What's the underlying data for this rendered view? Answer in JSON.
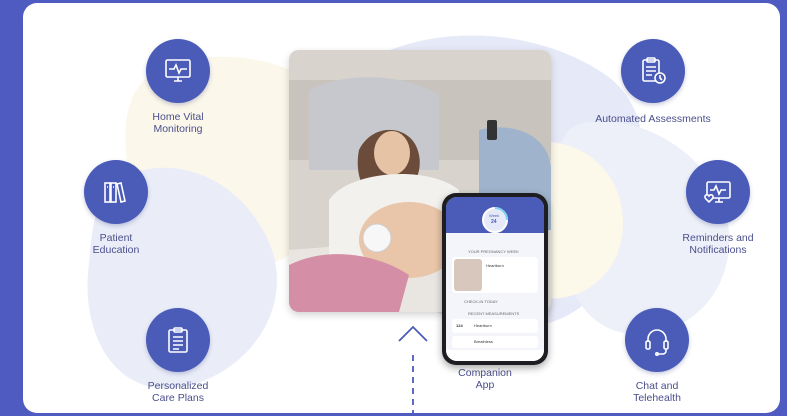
{
  "features": {
    "home_vital": "Home Vital\nMonitoring",
    "patient_education": "Patient\nEducation",
    "care_plans": "Personalized\nCare Plans",
    "companion_app": "Companion\nApp",
    "automated_assessments": "Automated Assessments",
    "reminders": "Reminders and\nNotifications",
    "chat": "Chat and\nTelehealth"
  },
  "icons": {
    "home_vital": "monitor-heart-icon",
    "patient_education": "books-icon",
    "care_plans": "clipboard-icon",
    "automated_assessments": "checklist-clock-icon",
    "reminders": "monitor-heart-icon",
    "chat": "headset-icon"
  },
  "colors": {
    "background": "#4f5bc0",
    "icon_circle": "#4a5bb8",
    "label": "#4a4f8c"
  },
  "phone_screen": {
    "ring_label": "Week",
    "ring_value": "24",
    "section1": "YOUR PREGNANCY WEEK",
    "card_title": "Heartburn",
    "section2": "CHECK-IN TODAY",
    "section3": "RECENT MEASUREMENTS",
    "row1_value": "124",
    "row1_title": "Heartburn",
    "row2_title": "Breathless"
  }
}
